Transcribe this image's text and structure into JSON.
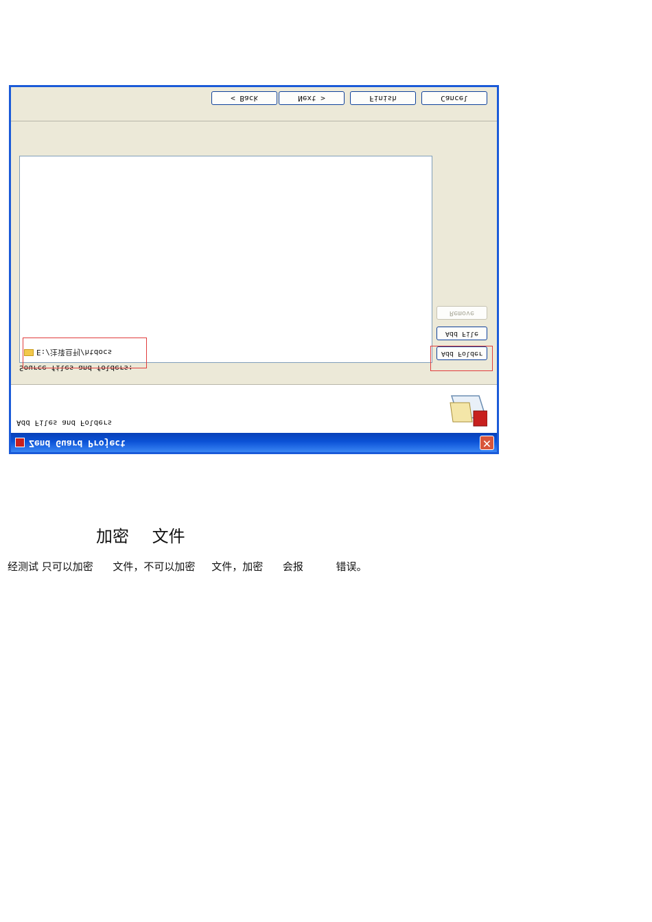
{
  "dialog": {
    "title": "Zend Guard Project",
    "close_glyph": "✕",
    "header_title": "Add Files and Folders",
    "logo_icon": "zend-guard-logo-icon",
    "source_label": "Source files and folders:",
    "items": [
      "E:/注译旦刊/htdocs"
    ],
    "remove_label": "Remove",
    "add_file_label": "Add File",
    "add_folder_label": "Add Folder",
    "back_label": "< Back",
    "next_label": "Next >",
    "finish_label": "Finish",
    "cancel_label": "Cancel",
    "highlight_color": "#e03a3a"
  },
  "doc": {
    "caption_a": "加密",
    "caption_b": "文件",
    "description": "经测试 只可以加密      文件，不可以加密     文件，加密      会报          错误。"
  }
}
